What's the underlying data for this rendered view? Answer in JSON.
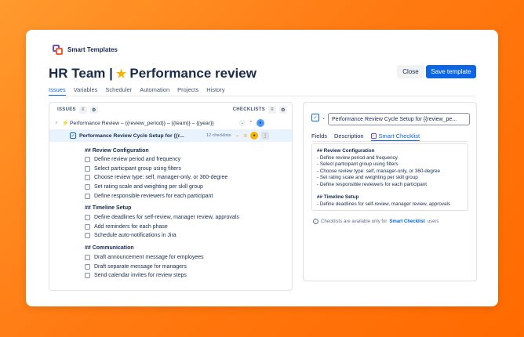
{
  "brand": {
    "name": "Smart Templates"
  },
  "header": {
    "title_prefix": "HR Team |",
    "title_name": "Performance review",
    "close_label": "Close",
    "save_label": "Save template"
  },
  "tabs": [
    "Issues",
    "Variables",
    "Scheduler",
    "Automation",
    "Projects",
    "History"
  ],
  "left_panel": {
    "col_issues": "ISSUES",
    "col_checklists": "CHECKLISTS",
    "rows": [
      {
        "title": "Performance Review – {{review_period}} – {{team}} – {{year}}"
      },
      {
        "title": "Performance Review Cycle Setup for {{r...",
        "checklist_count": "12 checklists"
      }
    ],
    "checklist": [
      {
        "heading": "## Review Configuration",
        "items": [
          "Define review period and frequency",
          "Select participant group using filters",
          "Choose review type: self, manager-only, or 360-degree",
          "Set rating scale and weighting per skill group",
          "Define responsible reviewers for each participant"
        ]
      },
      {
        "heading": "## Timeline Setup",
        "items": [
          "Define deadlines for self-review, manager review, approvals",
          "Add reminders for each phase",
          "Schedule auto-notifications in Jira"
        ]
      },
      {
        "heading": "## Communication",
        "items": [
          "Draft announcement message for employees",
          "Draft separate message for managers",
          "Send calendar invites for review steps"
        ]
      }
    ]
  },
  "right_panel": {
    "input_value": "Performance Review Cycle Setup for {{review_pe...",
    "tabs": [
      "Fields",
      "Description",
      "Smart Checklist"
    ],
    "preview": {
      "h1": "## Review Configuration",
      "lines1": [
        "- Define review period and frequency",
        "- Select participant group using filters",
        "- Choose review type: self, manager-only, or 360-degree",
        "- Set rating scale and weighting per skill group",
        "- Define responsible reviewers for each participant"
      ],
      "h2": "## Timeline Setup",
      "lines2": [
        "- Define deadlines for self-review, manager review, approvals"
      ]
    },
    "note_prefix": "Checklists are available only for",
    "note_link": "Smart Checklist",
    "note_suffix": "users"
  },
  "colors": {
    "accent": "#0c66e4",
    "background_gradient_start": "#ff9a2e",
    "background_gradient_end": "#ff6a00"
  },
  "icons": [
    "smart-templates-logo-icon",
    "star-icon",
    "sort-icon",
    "settings-icon",
    "chevron-right-icon",
    "issue-type-icon",
    "checkbox-icon",
    "priority-high-icon",
    "priority-medium-icon",
    "avatar-icon",
    "more-icon",
    "info-icon"
  ]
}
